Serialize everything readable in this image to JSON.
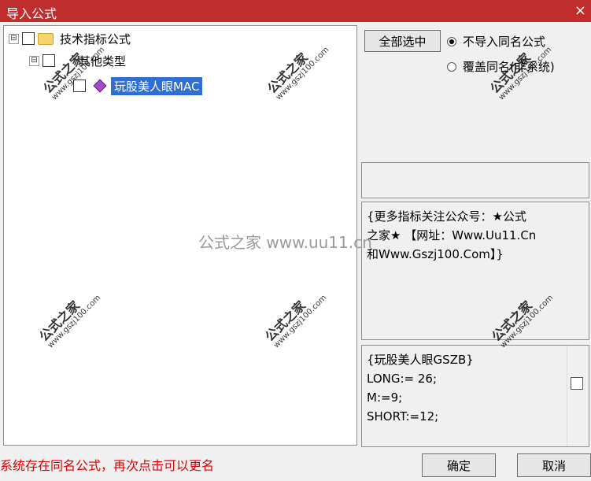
{
  "window": {
    "title": "导入公式",
    "close_icon": "×"
  },
  "tree": {
    "root_expander": "⊟",
    "root_label": "技术指标公式",
    "child_expander": "⊟",
    "child_label": "其他类型",
    "leaf_label": "玩股美人眼MAC"
  },
  "actions": {
    "select_all_label": "全部选中",
    "radio_no_import": "不导入同名公式",
    "radio_overwrite": "覆盖同名(非系统)"
  },
  "description": {
    "line1": "{更多指标关注公众号：★公式",
    "line2": "之家★ 【网址：Www.Uu11.Cn",
    "line3": "和Www.Gszj100.Com】}"
  },
  "code": {
    "lines": [
      "{玩股美人眼GSZB}",
      "LONG:= 26;",
      "M:=9;",
      "SHORT:=12;"
    ]
  },
  "status": {
    "message": "系统存在同名公式，再次点击可以更名"
  },
  "buttons": {
    "ok": "确定",
    "cancel": "取消"
  },
  "watermarks": {
    "stamp_big": "公式之家",
    "stamp_small": "www.gszj100.com",
    "center": "公式之家 www.uu11.cn"
  },
  "colors": {
    "title_bar": "#bf2d2d",
    "selection": "#2f6fd2",
    "status_text": "#e00000"
  }
}
